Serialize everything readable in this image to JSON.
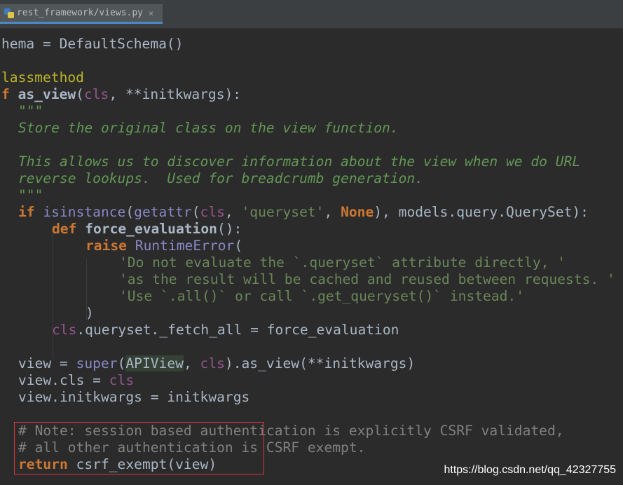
{
  "tab": {
    "label": "rest_framework/views.py",
    "close": "×",
    "icon": "python-file-icon"
  },
  "code": {
    "l01": "hema = DefaultSchema()",
    "l03": "lassmethod",
    "l04": {
      "kw": "f",
      "name": "as_view",
      "p1": "(",
      "self": "cls",
      "rest": ", **initkwargs):"
    },
    "l05": "\"\"\"",
    "l06": "Store the original class on the view function.",
    "l08": "This allows us to discover information about the view when we do URL",
    "l09": "reverse lookups.  Used for breadcrumb generation.",
    "l10": "\"\"\"",
    "l11": {
      "kw": "if",
      "b1": "isinstance",
      "p1": "(",
      "b2": "getattr",
      "p2": "(",
      "self": "cls",
      "c1": ", ",
      "str": "'queryset'",
      "c2": ", ",
      "none": "None",
      "rest": "), models.query.QuerySet):"
    },
    "l12": {
      "kw": "def",
      "name": "force_evaluation",
      "rest": "():"
    },
    "l13": {
      "kw": "raise",
      "cls": "RuntimeError",
      "rest": "("
    },
    "l14": "'Do not evaluate the `.queryset` attribute directly, '",
    "l15": "'as the result will be cached and reused between requests. '",
    "l16": "'Use `.all()` or call `.get_queryset()` instead.'",
    "l17": ")",
    "l18": {
      "self": "cls",
      "rest": ".queryset._fetch_all = force_evaluation"
    },
    "l20": {
      "a": "view = ",
      "b": "super",
      "c": "(",
      "d": "APIView",
      "e": ", ",
      "f": "cls",
      "g": ").as_view(**initkwargs)"
    },
    "l21": {
      "a": "view.cls = ",
      "b": "cls"
    },
    "l22": "view.initkwargs = initkwargs",
    "l24": "# Note: session based authentication is explicitly CSRF validated,",
    "l25": "# all other authentication is CSRF exempt.",
    "l26": {
      "kw": "return",
      "rest": " csrf_exempt(view)"
    }
  },
  "watermark": "https://blog.csdn.net/qq_42327755"
}
